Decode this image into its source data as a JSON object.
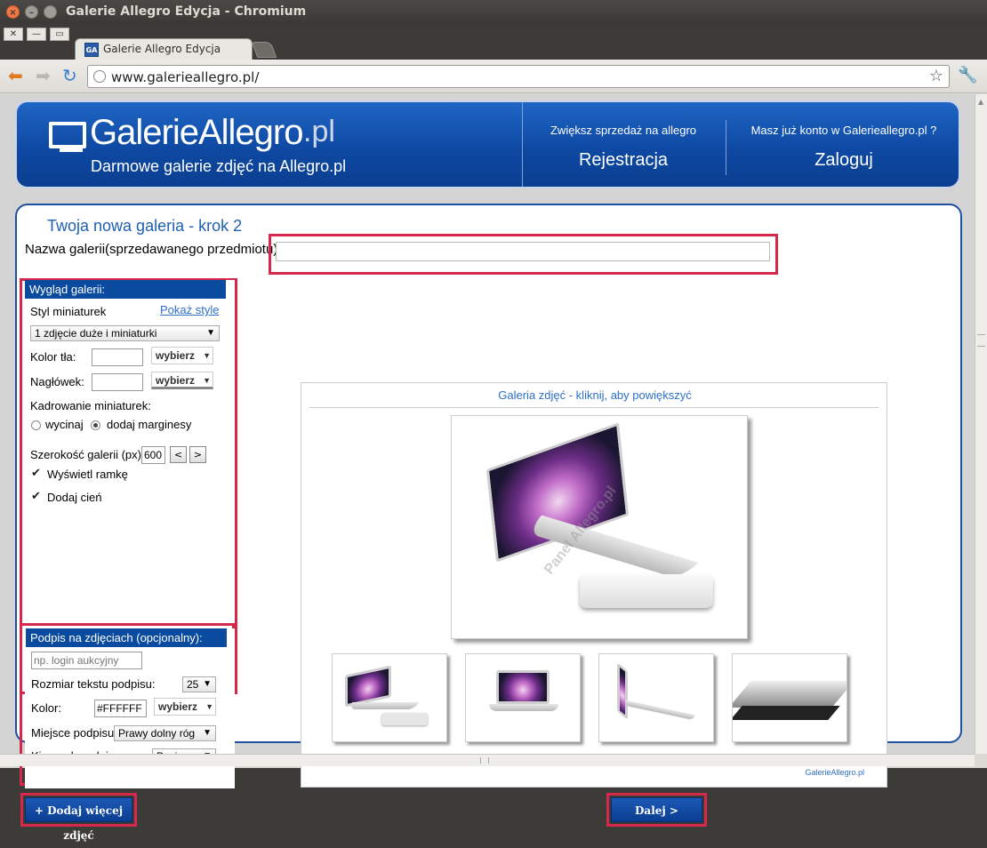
{
  "window": {
    "title": "Galerie Allegro Edycja - Chromium",
    "tab_label": "Galerie Allegro Edycja",
    "favicon_text": "GA",
    "url": "www.galerieallegro.pl/"
  },
  "banner": {
    "logo_main": "GalerieAllegro",
    "logo_suffix": ".pl",
    "tagline": "Darmowe galerie zdjęć na Allegro.pl",
    "promo_register": "Zwiększ sprzedaż na allegro",
    "register": "Rejestracja",
    "promo_login": "Masz już konto w Galerieallegro.pl ?",
    "login": "Zaloguj"
  },
  "form": {
    "step_title": "Twoja nowa galeria - krok 2",
    "name_label": "Nazwa galerii(sprzedawanego przedmiotu):",
    "name_value": ""
  },
  "appearance": {
    "header": "Wygląd galerii:",
    "thumb_style_label": "Styl miniaturek",
    "show_styles": "Pokaż style",
    "thumb_style_value": "1 zdjęcie duże i miniaturki",
    "bg_color_label": "Kolor tła:",
    "header_label": "Nagłówek:",
    "pick_label": "wybierz",
    "crop_label": "Kadrowanie miniaturek:",
    "crop_options": [
      "wycinaj",
      "dodaj marginesy"
    ],
    "crop_selected": "dodaj marginesy",
    "width_label": "Szerokość galerii (px):",
    "width_value": "600",
    "dec": "<",
    "inc": ">",
    "show_frame": "Wyświetl ramkę",
    "add_shadow": "Dodaj cień"
  },
  "caption": {
    "header": "Podpis na zdjęciach (opcjonalny):",
    "text_placeholder": "np. login aukcyjny",
    "size_label": "Rozmiar tekstu podpisu:",
    "size_value": "25",
    "color_label": "Kolor:",
    "color_value": "#FFFFFF",
    "pick_label": "wybierz",
    "place_label": "Miejsce podpisu:",
    "place_value": "Prawy dolny róg",
    "dir_label": "Kierunek podpisu:",
    "dir_value": "Poziomo"
  },
  "preview": {
    "caption": "Galeria zdjęć - kliknij, aby powiększyć",
    "watermark": "Panel Allegro.pl",
    "brand": "GalerieAllegro.pl"
  },
  "buttons": {
    "add_more": "+ Dodaj więcej zdjęć",
    "next": "Dalej >"
  },
  "colors": {
    "brand_blue": "#0a4ba0",
    "highlight_red": "#d5284a",
    "link_blue": "#2e6fc8"
  }
}
